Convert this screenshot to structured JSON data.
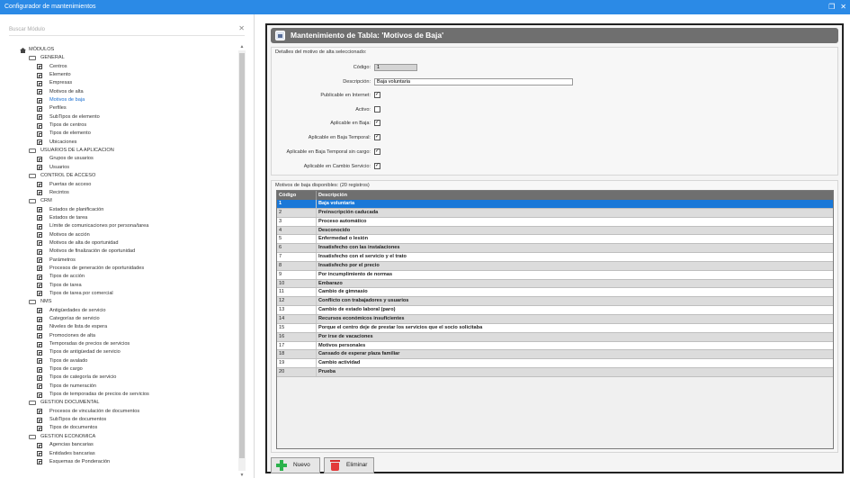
{
  "window": {
    "title": "Configurador de mantenimientos"
  },
  "left": {
    "search_placeholder": "Buscar Módulo",
    "root": "MÓDULOS",
    "tree": [
      {
        "type": "cat",
        "label": "GENERAL"
      },
      {
        "type": "item",
        "label": "Centros"
      },
      {
        "type": "item",
        "label": "Elemento"
      },
      {
        "type": "item",
        "label": "Empresas"
      },
      {
        "type": "item",
        "label": "Motivos de alta"
      },
      {
        "type": "item",
        "label": "Motivos de baja",
        "selected": true
      },
      {
        "type": "item",
        "label": "Perfiles"
      },
      {
        "type": "item",
        "label": "SubTipos de elemento"
      },
      {
        "type": "item",
        "label": "Tipos de centros"
      },
      {
        "type": "item",
        "label": "Tipos de elemento"
      },
      {
        "type": "item",
        "label": "Ubicaciones"
      },
      {
        "type": "cat",
        "label": "USUARIOS DE LA APLICACION"
      },
      {
        "type": "item",
        "label": "Grupos de usuarios"
      },
      {
        "type": "item",
        "label": "Usuarios"
      },
      {
        "type": "cat",
        "label": "CONTROL DE ACCESO"
      },
      {
        "type": "item",
        "label": "Puertas de acceso"
      },
      {
        "type": "item",
        "label": "Recintos"
      },
      {
        "type": "cat",
        "label": "CRM"
      },
      {
        "type": "item",
        "label": "Estados de planificación"
      },
      {
        "type": "item",
        "label": "Estados de tarea"
      },
      {
        "type": "item",
        "label": "Límite de comunicaciones por persona/tarea"
      },
      {
        "type": "item",
        "label": "Motivos de acción"
      },
      {
        "type": "item",
        "label": "Motivos de alta de oportunidad"
      },
      {
        "type": "item",
        "label": "Motivos de finalización de oportunidad"
      },
      {
        "type": "item",
        "label": "Parámetros"
      },
      {
        "type": "item",
        "label": "Procesos de generación de oportunidades"
      },
      {
        "type": "item",
        "label": "Tipos de acción"
      },
      {
        "type": "item",
        "label": "Tipos de tarea"
      },
      {
        "type": "item",
        "label": "Tipos de tarea por comercial"
      },
      {
        "type": "cat",
        "label": "NMS"
      },
      {
        "type": "item",
        "label": "Antigüedades de servicio"
      },
      {
        "type": "item",
        "label": "Categorías de servicio"
      },
      {
        "type": "item",
        "label": "Niveles de lista de espera"
      },
      {
        "type": "item",
        "label": "Promociones de alta"
      },
      {
        "type": "item",
        "label": "Temporadas de precios de servicios"
      },
      {
        "type": "item",
        "label": "Tipos de antigüedad de servicio"
      },
      {
        "type": "item",
        "label": "Tipos de avalado"
      },
      {
        "type": "item",
        "label": "Tipos de cargo"
      },
      {
        "type": "item",
        "label": "Tipos de categoría de servicio"
      },
      {
        "type": "item",
        "label": "Tipos de numeración"
      },
      {
        "type": "item",
        "label": "Tipos de temporadas de precios de servicios"
      },
      {
        "type": "cat",
        "label": "GESTION DOCUMENTAL"
      },
      {
        "type": "item",
        "label": "Procesos de vinculación de documentos"
      },
      {
        "type": "item",
        "label": "SubTipos de documentos"
      },
      {
        "type": "item",
        "label": "Tipos de documentos"
      },
      {
        "type": "cat",
        "label": "GESTION ECONOMICA"
      },
      {
        "type": "item",
        "label": "Agencias bancarias"
      },
      {
        "type": "item",
        "label": "Entidades bancarias"
      },
      {
        "type": "item",
        "label": "Esquemas de Ponderación"
      }
    ]
  },
  "main": {
    "title": "Mantenimiento de Tabla: 'Motivos de Baja'",
    "details_legend": "Detalles del motivo de alta seleccionado:",
    "fields": {
      "codigo_label": "Código:",
      "codigo_value": "1",
      "descripcion_label": "Descripción:",
      "descripcion_value": "Baja voluntaria",
      "publicable_label": "Publicable en Internet:",
      "activo_label": "Activo:",
      "aplicable_baja_label": "Aplicable en Baja:",
      "aplicable_temporal_label": "Aplicable en Baja Temporal:",
      "aplicable_temporal_sin_label": "Aplicable en Baja Temporal sin cargo:",
      "aplicable_cambio_label": "Aplicable en Cambio Servicio:",
      "check_mark": "✓"
    },
    "list_legend": "Motivos de baja disponibles:  (20 registros)",
    "grid": {
      "col_codigo": "Código",
      "col_descripcion": "Descripción",
      "rows": [
        {
          "c": "1",
          "d": "Baja voluntaria"
        },
        {
          "c": "2",
          "d": "Preinscripción caducada"
        },
        {
          "c": "3",
          "d": "Proceso automático"
        },
        {
          "c": "4",
          "d": "Desconocido"
        },
        {
          "c": "5",
          "d": "Enfermedad o lesión"
        },
        {
          "c": "6",
          "d": "Insatisfecho con las instalaciones"
        },
        {
          "c": "7",
          "d": "Insatisfecho con el servicio y el trato"
        },
        {
          "c": "8",
          "d": "Insatisfecho por el precio"
        },
        {
          "c": "9",
          "d": "Por incumplimiento de normas"
        },
        {
          "c": "10",
          "d": "Embarazo"
        },
        {
          "c": "11",
          "d": "Cambio de gimnasio"
        },
        {
          "c": "12",
          "d": "Conflicto con trabajadores y usuarios"
        },
        {
          "c": "13",
          "d": "Cambio de estado laboral (paro)"
        },
        {
          "c": "14",
          "d": "Recursos económicos insuficientes"
        },
        {
          "c": "15",
          "d": "Porque el centro deje de prestar los servicios que el socio solicitaba"
        },
        {
          "c": "16",
          "d": "Por irse de vacaciones"
        },
        {
          "c": "17",
          "d": "Motivos personales"
        },
        {
          "c": "18",
          "d": "Cansado de esperar plaza familiar"
        },
        {
          "c": "19",
          "d": "Cambio actividad"
        },
        {
          "c": "20",
          "d": "Prueba"
        }
      ]
    },
    "buttons": {
      "nuevo": "Nuevo",
      "eliminar": "Eliminar"
    }
  }
}
